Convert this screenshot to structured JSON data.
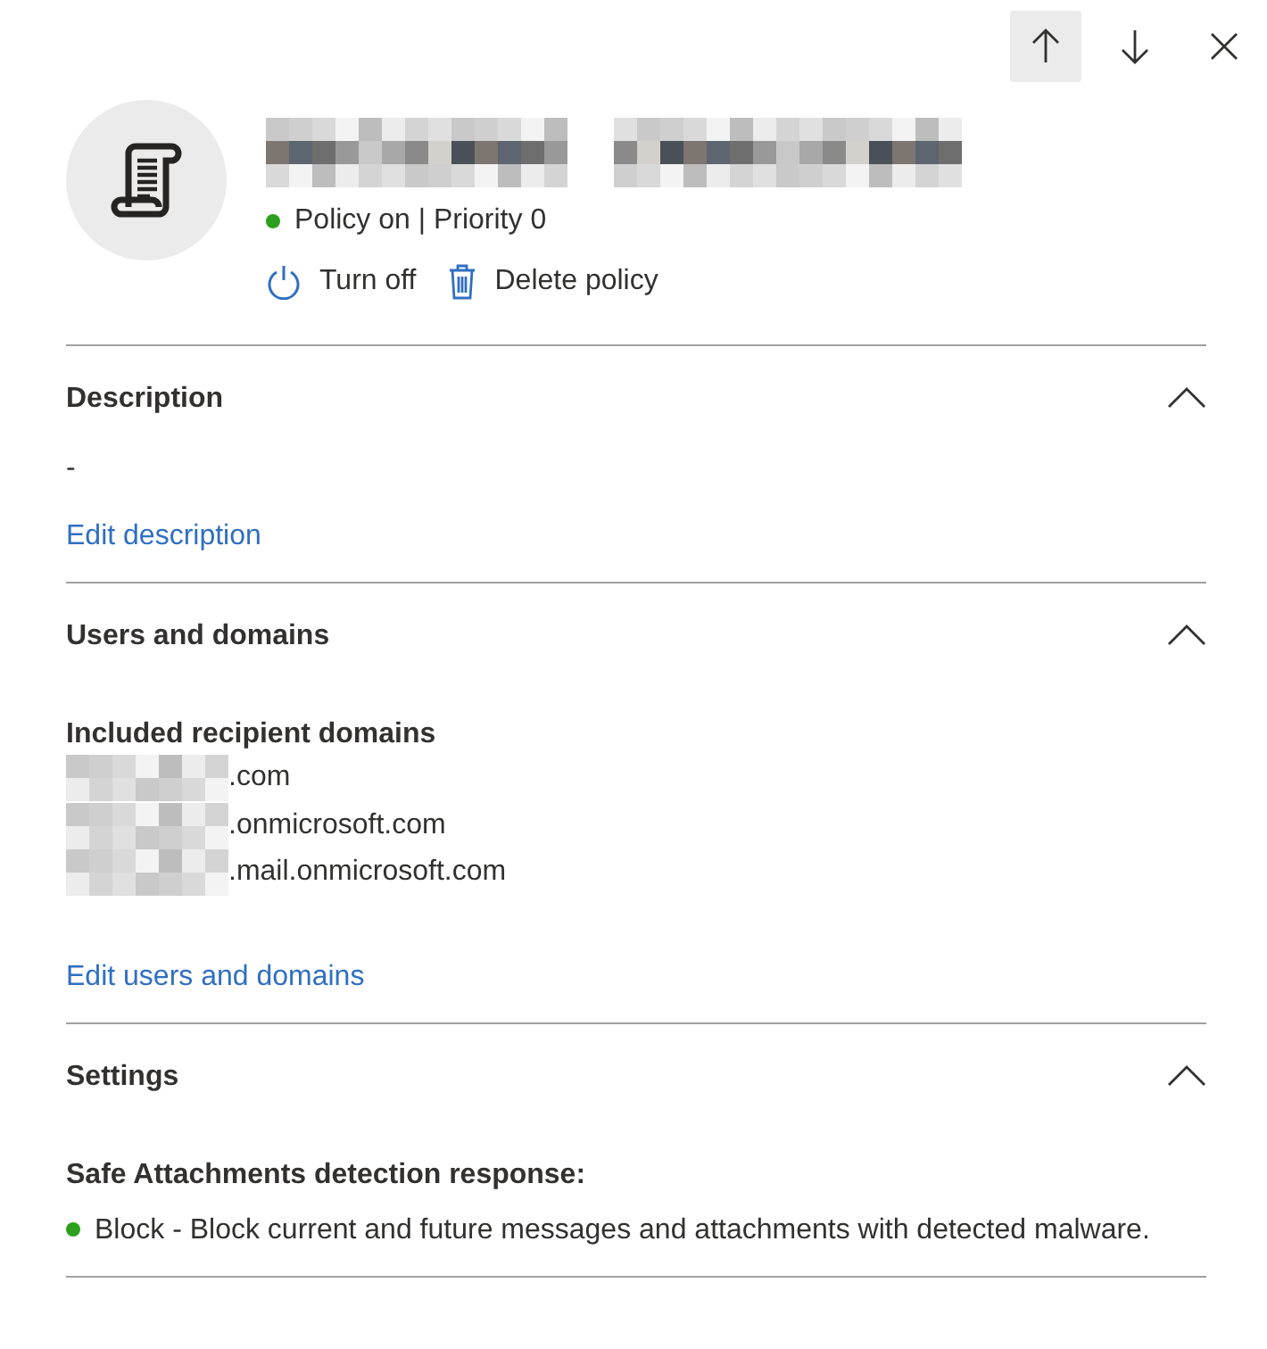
{
  "header_buttons": [
    {
      "kind": "up",
      "selected": true
    },
    {
      "kind": "down",
      "selected": false
    },
    {
      "kind": "close",
      "selected": false
    }
  ],
  "policy": {
    "on": true,
    "status": "Policy on | Priority 0"
  },
  "actions": [
    {
      "kind": "power",
      "label": "Turn off"
    },
    {
      "kind": "delete",
      "label": "Delete policy"
    }
  ],
  "sections": [
    {
      "kind": "description",
      "title": "Description",
      "expanded": true,
      "value": "-",
      "link": "Edit description"
    },
    {
      "kind": "domains",
      "title": "Users and domains",
      "expanded": true,
      "subtitle": "Included recipient domains",
      "domains": [
        ".com",
        ".onmicrosoft.com",
        ".mail.onmicrosoft.com"
      ],
      "link": "Edit users and domains"
    },
    {
      "kind": "settings",
      "title": "Settings",
      "expanded": true,
      "subtitle": "Safe Attachments detection response:",
      "items": [
        {
          "on": true,
          "text": "Block - Block current and future messages and attachments with detected malware."
        }
      ]
    }
  ]
}
